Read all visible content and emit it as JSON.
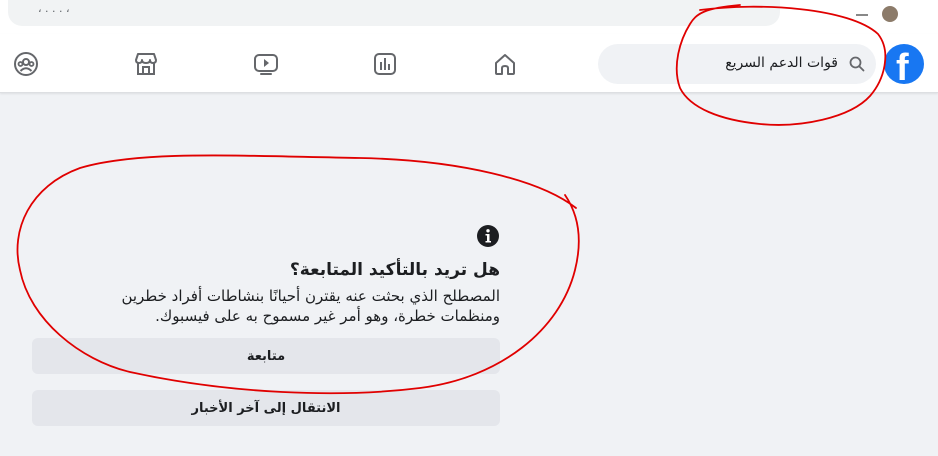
{
  "browser": {
    "address_fragment": "، . . . ،"
  },
  "header": {
    "logo_letter": "f",
    "search": {
      "value": "قوات الدعم السريع"
    },
    "nav_icons": [
      "home-icon",
      "stats-icon",
      "watch-icon",
      "marketplace-icon",
      "groups-icon"
    ]
  },
  "dialog": {
    "title": "هل تريد بالتأكيد المتابعة؟",
    "body": "المصطلح الذي بحثت عنه يقترن أحيانًا بنشاطات أفراد خطرين ومنظمات خطرة، وهو أمر غير مسموح به على فيسبوك.",
    "continue_label": "متابعة",
    "news_label": "الانتقال إلى آخر الأخبار"
  },
  "colors": {
    "brand": "#1877f2",
    "background": "#f0f2f5",
    "button": "#e4e6eb",
    "annotation": "#e00000"
  }
}
